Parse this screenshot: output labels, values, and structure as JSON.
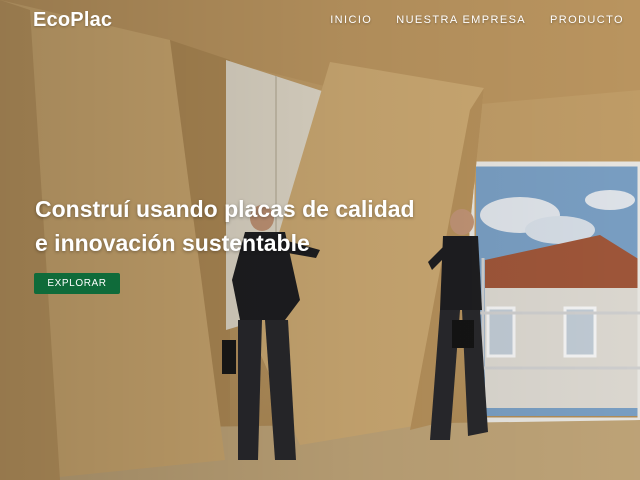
{
  "brand": {
    "name": "EcoPlac"
  },
  "nav": {
    "items": [
      {
        "label": "INICIO"
      },
      {
        "label": "NUESTRA EMPRESA"
      },
      {
        "label": "PRODUCTO"
      }
    ]
  },
  "hero": {
    "headline_line1": "Construí usando placas de calidad",
    "headline_line2": "e innovación sustentable",
    "cta_label": "EXPLORAR"
  },
  "colors": {
    "cta_background": "#0f6b3a",
    "text": "#ffffff",
    "wood": "#c8a26a"
  }
}
